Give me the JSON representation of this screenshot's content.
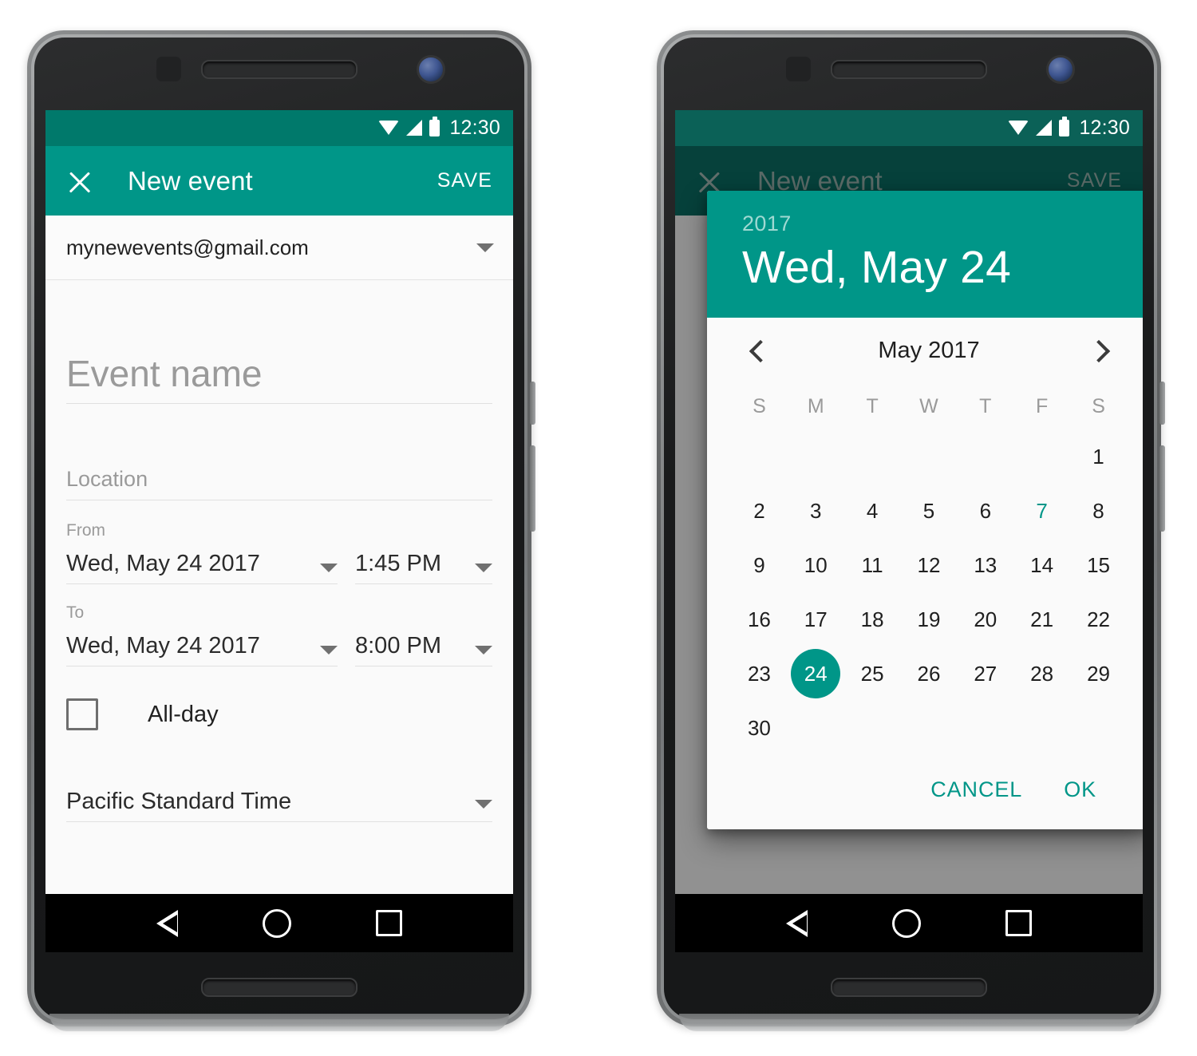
{
  "theme": {
    "accent": "#009688",
    "statusbar": "#00796b",
    "dim_appbar": "#0b7166",
    "selected_day_bg": "#009688",
    "today_text": "#009688",
    "placeholder_text": "#9a9a9a"
  },
  "phone_left": {
    "statusbar": {
      "time": "12:30",
      "icons": [
        "wifi-icon",
        "signal-icon",
        "battery-icon"
      ]
    },
    "appbar": {
      "close_label": "close-icon",
      "title": "New event",
      "save_label": "SAVE"
    },
    "form": {
      "account": "mynewevents@gmail.com",
      "event_name_placeholder": "Event name",
      "event_name_value": "",
      "location_placeholder": "Location",
      "location_value": "",
      "from_label": "From",
      "from_date": "Wed, May 24 2017",
      "from_time": "1:45 PM",
      "to_label": "To",
      "to_date": "Wed, May 24 2017",
      "to_time": "8:00 PM",
      "allday_label": "All-day",
      "allday_checked": false,
      "timezone": "Pacific Standard Time"
    },
    "navbar": {
      "back": "back-icon",
      "home": "home-icon",
      "recents": "recents-icon"
    }
  },
  "phone_right": {
    "statusbar": {
      "time": "12:30",
      "icons": [
        "wifi-icon",
        "signal-icon",
        "battery-icon"
      ]
    },
    "appbar": {
      "close_label": "close-icon",
      "title": "New event",
      "save_label": "SAVE"
    },
    "date_picker": {
      "header_year": "2017",
      "header_date": "Wed, May 24",
      "month_label": "May 2017",
      "prev_label": "chevron-left-icon",
      "next_label": "chevron-right-icon",
      "weekdays": [
        "S",
        "M",
        "T",
        "W",
        "T",
        "F",
        "S"
      ],
      "weeks": [
        [
          "",
          "",
          "",
          "",
          "",
          "",
          "1"
        ],
        [
          "2",
          "3",
          "4",
          "5",
          "6",
          "7",
          "8"
        ],
        [
          "9",
          "10",
          "11",
          "12",
          "13",
          "14",
          "15"
        ],
        [
          "16",
          "17",
          "18",
          "19",
          "20",
          "21",
          "22"
        ],
        [
          "23",
          "24",
          "25",
          "26",
          "27",
          "28",
          "29"
        ],
        [
          "30",
          "",
          "",
          "",
          "",
          "",
          ""
        ]
      ],
      "selected_day": "24",
      "today_day": "7",
      "cancel_label": "CANCEL",
      "ok_label": "OK"
    },
    "navbar": {
      "back": "back-icon",
      "home": "home-icon",
      "recents": "recents-icon"
    }
  }
}
